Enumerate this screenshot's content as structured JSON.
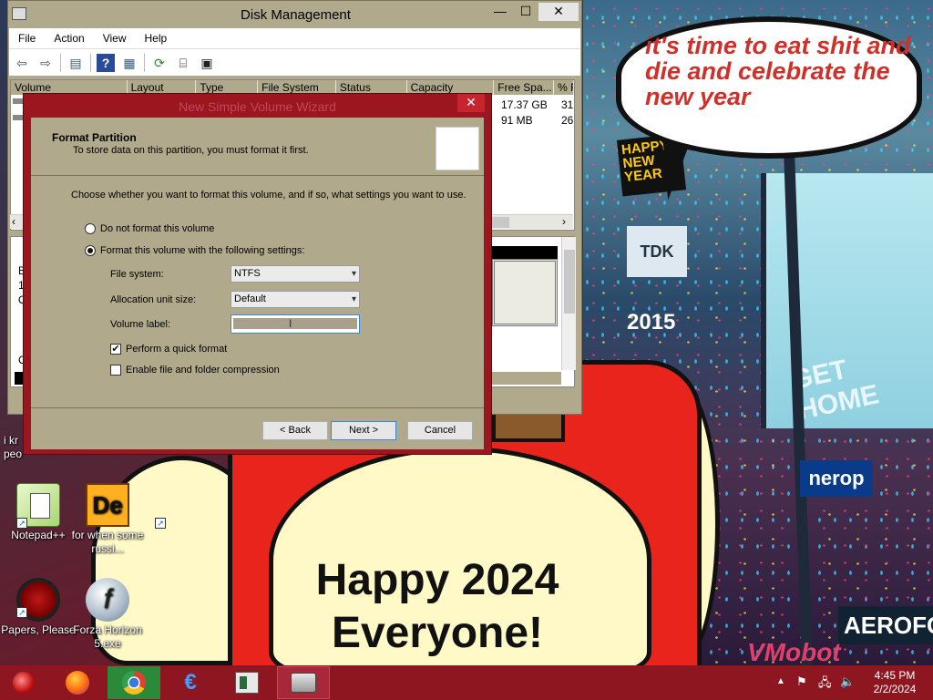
{
  "disk_management": {
    "title": "Disk Management",
    "controls": {
      "minimize": "—",
      "maximize": "☐",
      "close": "✕"
    },
    "menu": [
      "File",
      "Action",
      "View",
      "Help"
    ],
    "columns": [
      "Volume",
      "Layout",
      "Type",
      "File System",
      "Status",
      "Capacity",
      "Free Spa...",
      "% F"
    ],
    "rows": [
      {
        "free_space": "17.37 GB",
        "percent_free": "31"
      },
      {
        "free_space": "91 MB",
        "percent_free": "26"
      }
    ],
    "graph_fragments": [
      "B",
      "1",
      "O",
      "C"
    ]
  },
  "wizard": {
    "title": "New Simple Volume Wizard",
    "close": "✕",
    "header_title": "Format Partition",
    "header_subtitle": "To store data on this partition, you must format it first.",
    "intro": "Choose whether you want to format this volume, and if so, what settings you want to use.",
    "option_no_format": "Do not format this volume",
    "option_format": "Format this volume with the following settings:",
    "file_system_label": "File system:",
    "file_system_value": "NTFS",
    "allocation_label": "Allocation unit size:",
    "allocation_value": "Default",
    "volume_label_label": "Volume label:",
    "volume_label_value": "",
    "quick_format_label": "Perform a quick format",
    "quick_format_checked": true,
    "compression_label": "Enable file and folder compression",
    "compression_checked": false,
    "back_button": "< Back",
    "next_button": "Next >",
    "cancel_button": "Cancel"
  },
  "desktop": {
    "icons": [
      {
        "label": "Notepad++"
      },
      {
        "label": "for when some russi..."
      },
      {
        "label": "Papers, Please"
      },
      {
        "label": "Forza Horizon 5.exe"
      }
    ],
    "partial_icon_label": "i kr peo",
    "de_icon_text": "De",
    "flash_icon_text": "f"
  },
  "wallpaper": {
    "speech_bubble": "it's time to eat shit and die and celebrate the new year",
    "happy_sign": "Happy 2024 Everyone!",
    "times_square_sign": "HAPPY NEW YEAR",
    "tdk_sign": "TDK",
    "year_sign": "2015",
    "billboard": "GET HOME",
    "aero_sign": "AEROFOS",
    "nerop_sign": "nerop",
    "watermark": "VMobot"
  },
  "taskbar": {
    "time": "4:45 PM",
    "date": "2/2/2024",
    "tray": {
      "chevron": "▲",
      "flag": "⚑",
      "network": "🖧",
      "volume": "🔈"
    }
  },
  "colors": {
    "window_face": "#b0a98c",
    "wizard_frame": "#9c1620",
    "taskbar": "#8e1620"
  }
}
